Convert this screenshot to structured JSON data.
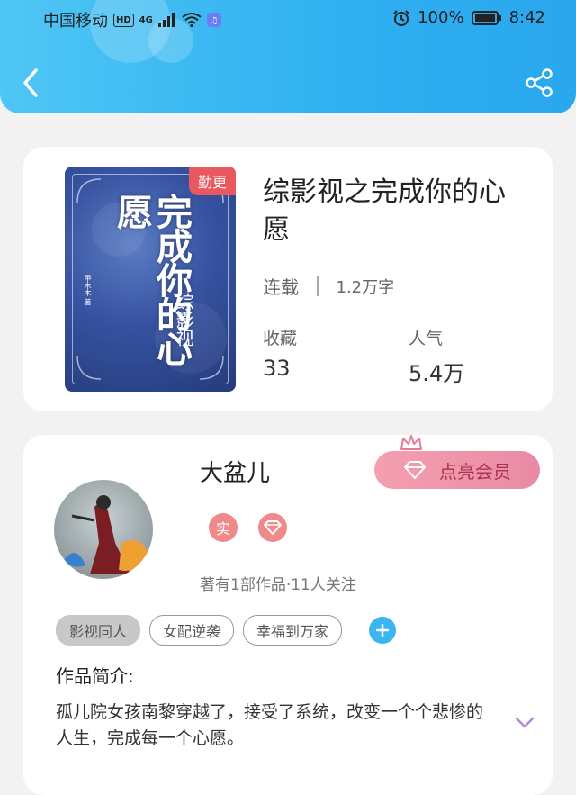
{
  "statusbar": {
    "carrier": "中国移动",
    "hd": "HD",
    "network": "4G",
    "battery": "100%",
    "time": "8:42"
  },
  "book": {
    "title": "综影视之完成你的心愿",
    "tag": "勤更",
    "status": "连载",
    "word_count": "1.2万字",
    "favorites_label": "收藏",
    "favorites_value": "33",
    "popularity_label": "人气",
    "popularity_value": "5.4万",
    "cover_title": "完成你的心愿",
    "cover_sub": "综影视",
    "cover_author": "甲木木 著"
  },
  "author": {
    "name": "大盆儿",
    "vip_button": "点亮会员",
    "real_badge": "实",
    "meta": "著有1部作品·11人关注"
  },
  "tags": [
    "影视同人",
    "女配逆袭",
    "幸福到万家"
  ],
  "intro": {
    "label": "作品简介:",
    "text": "孤儿院女孩南黎穿越了，接受了系统，改变一个个悲惨的人生，完成每一个心愿。"
  },
  "icons": {
    "back": "back-arrow-icon",
    "share": "share-icon",
    "expand": "chevron-down-icon",
    "diamond": "diamond-icon",
    "crown": "crown-icon"
  },
  "colors": {
    "header": "#2fb0f0",
    "tag_red": "#e8585e",
    "vip_pink": "#e98aa5",
    "add_blue": "#39b6ef",
    "expand_purple": "#b48ad8"
  }
}
